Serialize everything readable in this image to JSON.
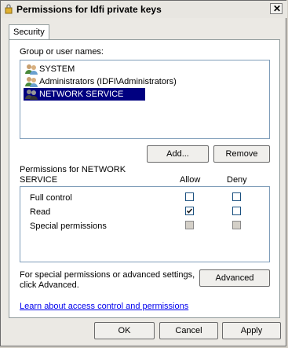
{
  "window": {
    "title": "Permissions for Idfi private keys",
    "close_label": "✕"
  },
  "tabs": [
    {
      "label": "Security"
    }
  ],
  "group_section": {
    "label": "Group or user names:",
    "users": [
      {
        "name": "SYSTEM",
        "icon": "user-group-icon"
      },
      {
        "name": "Administrators (IDFI\\Administrators)",
        "icon": "user-group-icon"
      },
      {
        "name": "NETWORK SERVICE",
        "icon": "user-group-icon",
        "selected": true
      }
    ]
  },
  "buttons": {
    "add": "Add...",
    "remove": "Remove",
    "advanced": "Advanced",
    "ok": "OK",
    "cancel": "Cancel",
    "apply": "Apply"
  },
  "permissions": {
    "label_line1": "Permissions for NETWORK",
    "label_line2": "SERVICE",
    "allow_header": "Allow",
    "deny_header": "Deny",
    "rows": [
      {
        "name": "Full control",
        "allow": false,
        "deny": false,
        "greyed": false
      },
      {
        "name": "Read",
        "allow": true,
        "deny": false,
        "greyed": false
      },
      {
        "name": "Special permissions",
        "allow": false,
        "deny": false,
        "greyed": true
      }
    ]
  },
  "advanced_text_line1": "For special permissions or advanced settings,",
  "advanced_text_line2": "click Advanced.",
  "help_link": "Learn about access control and permissions",
  "colors": {
    "selection": "#000080",
    "link": "#0000ee"
  }
}
